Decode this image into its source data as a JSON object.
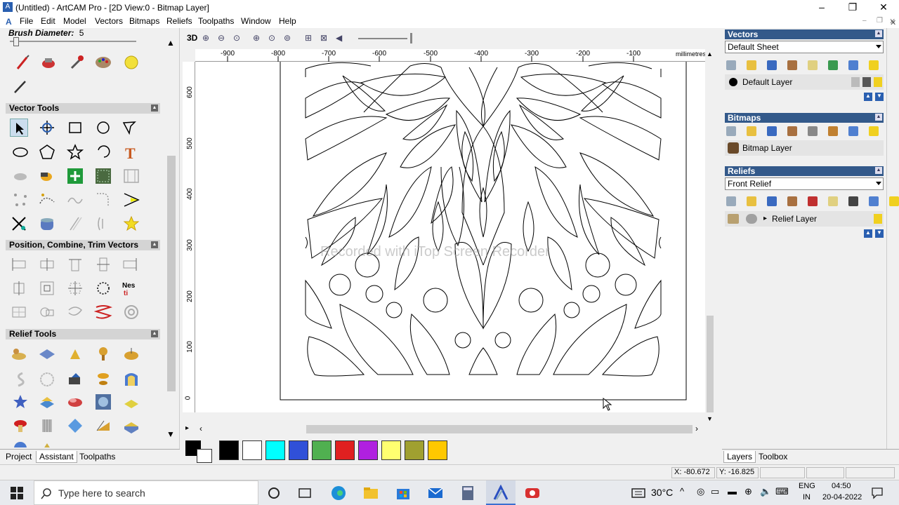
{
  "window": {
    "title": "(Untitled) - ArtCAM Pro - [2D View:0 - Bitmap Layer]",
    "minimize": "–",
    "restore": "❐",
    "close": "✕"
  },
  "menu": [
    "File",
    "Edit",
    "Model",
    "Vectors",
    "Bitmaps",
    "Reliefs",
    "Toolpaths",
    "Window",
    "Help"
  ],
  "left_panel": {
    "brush_label": "Brush Diameter:",
    "brush_value": "5",
    "sections": [
      "Vector Tools",
      "Position, Combine, Trim Vectors",
      "Relief Tools"
    ],
    "tabs": [
      "Project",
      "Assistant",
      "Toolpaths"
    ]
  },
  "view": {
    "toolbar_3d": "3D",
    "units": "millimetres",
    "h_ticks": [
      "-900",
      "-800",
      "-700",
      "-600",
      "-500",
      "-400",
      "-300",
      "-200",
      "-100"
    ],
    "v_ticks": [
      "600",
      "500",
      "400",
      "300",
      "200",
      "100",
      "0"
    ]
  },
  "palette": {
    "colors": [
      "#000000",
      "#ffffff",
      "#00ffff",
      "#3050d8",
      "#50b050",
      "#e02020",
      "#b020e0",
      "#ffff70",
      "#a0a030",
      "#ffc800"
    ]
  },
  "right_panel": {
    "vectors": {
      "header": "Vectors",
      "sheet": "Default Sheet",
      "layer": "Default Layer"
    },
    "bitmaps": {
      "header": "Bitmaps",
      "layer": "Bitmap Layer"
    },
    "reliefs": {
      "header": "Reliefs",
      "relief": "Front Relief",
      "layer": "Relief Layer"
    },
    "tabs": [
      "Layers",
      "Toolbox"
    ]
  },
  "status": {
    "x": "X: -80.672",
    "y": "Y: -16.825"
  },
  "watermark": "Recorded with iTop Screen Recorder",
  "taskbar": {
    "search_placeholder": "Type here to search",
    "weather": "30°C",
    "lang1": "ENG",
    "lang2": "IN",
    "time": "04:50",
    "date": "20-04-2022"
  }
}
